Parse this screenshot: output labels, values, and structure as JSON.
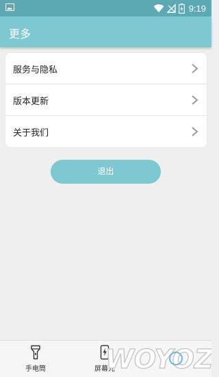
{
  "status_bar": {
    "time": "9:19"
  },
  "app_bar": {
    "title": "更多"
  },
  "menu": {
    "items": [
      {
        "label": "服务与隐私"
      },
      {
        "label": "版本更新"
      },
      {
        "label": "关于我们"
      }
    ]
  },
  "logout_button": {
    "label": "退出"
  },
  "bottom_nav": {
    "tabs": [
      {
        "label": "手电筒",
        "icon": "flashlight-icon"
      },
      {
        "label": "屏幕光",
        "icon": "screen-light-icon"
      }
    ]
  },
  "watermark": {
    "text": "WOYOZ",
    "icon": "watermark-logo"
  },
  "colors": {
    "status_bar": "#5da9b3",
    "accent": "#7dc8d1",
    "background": "#efefef"
  }
}
